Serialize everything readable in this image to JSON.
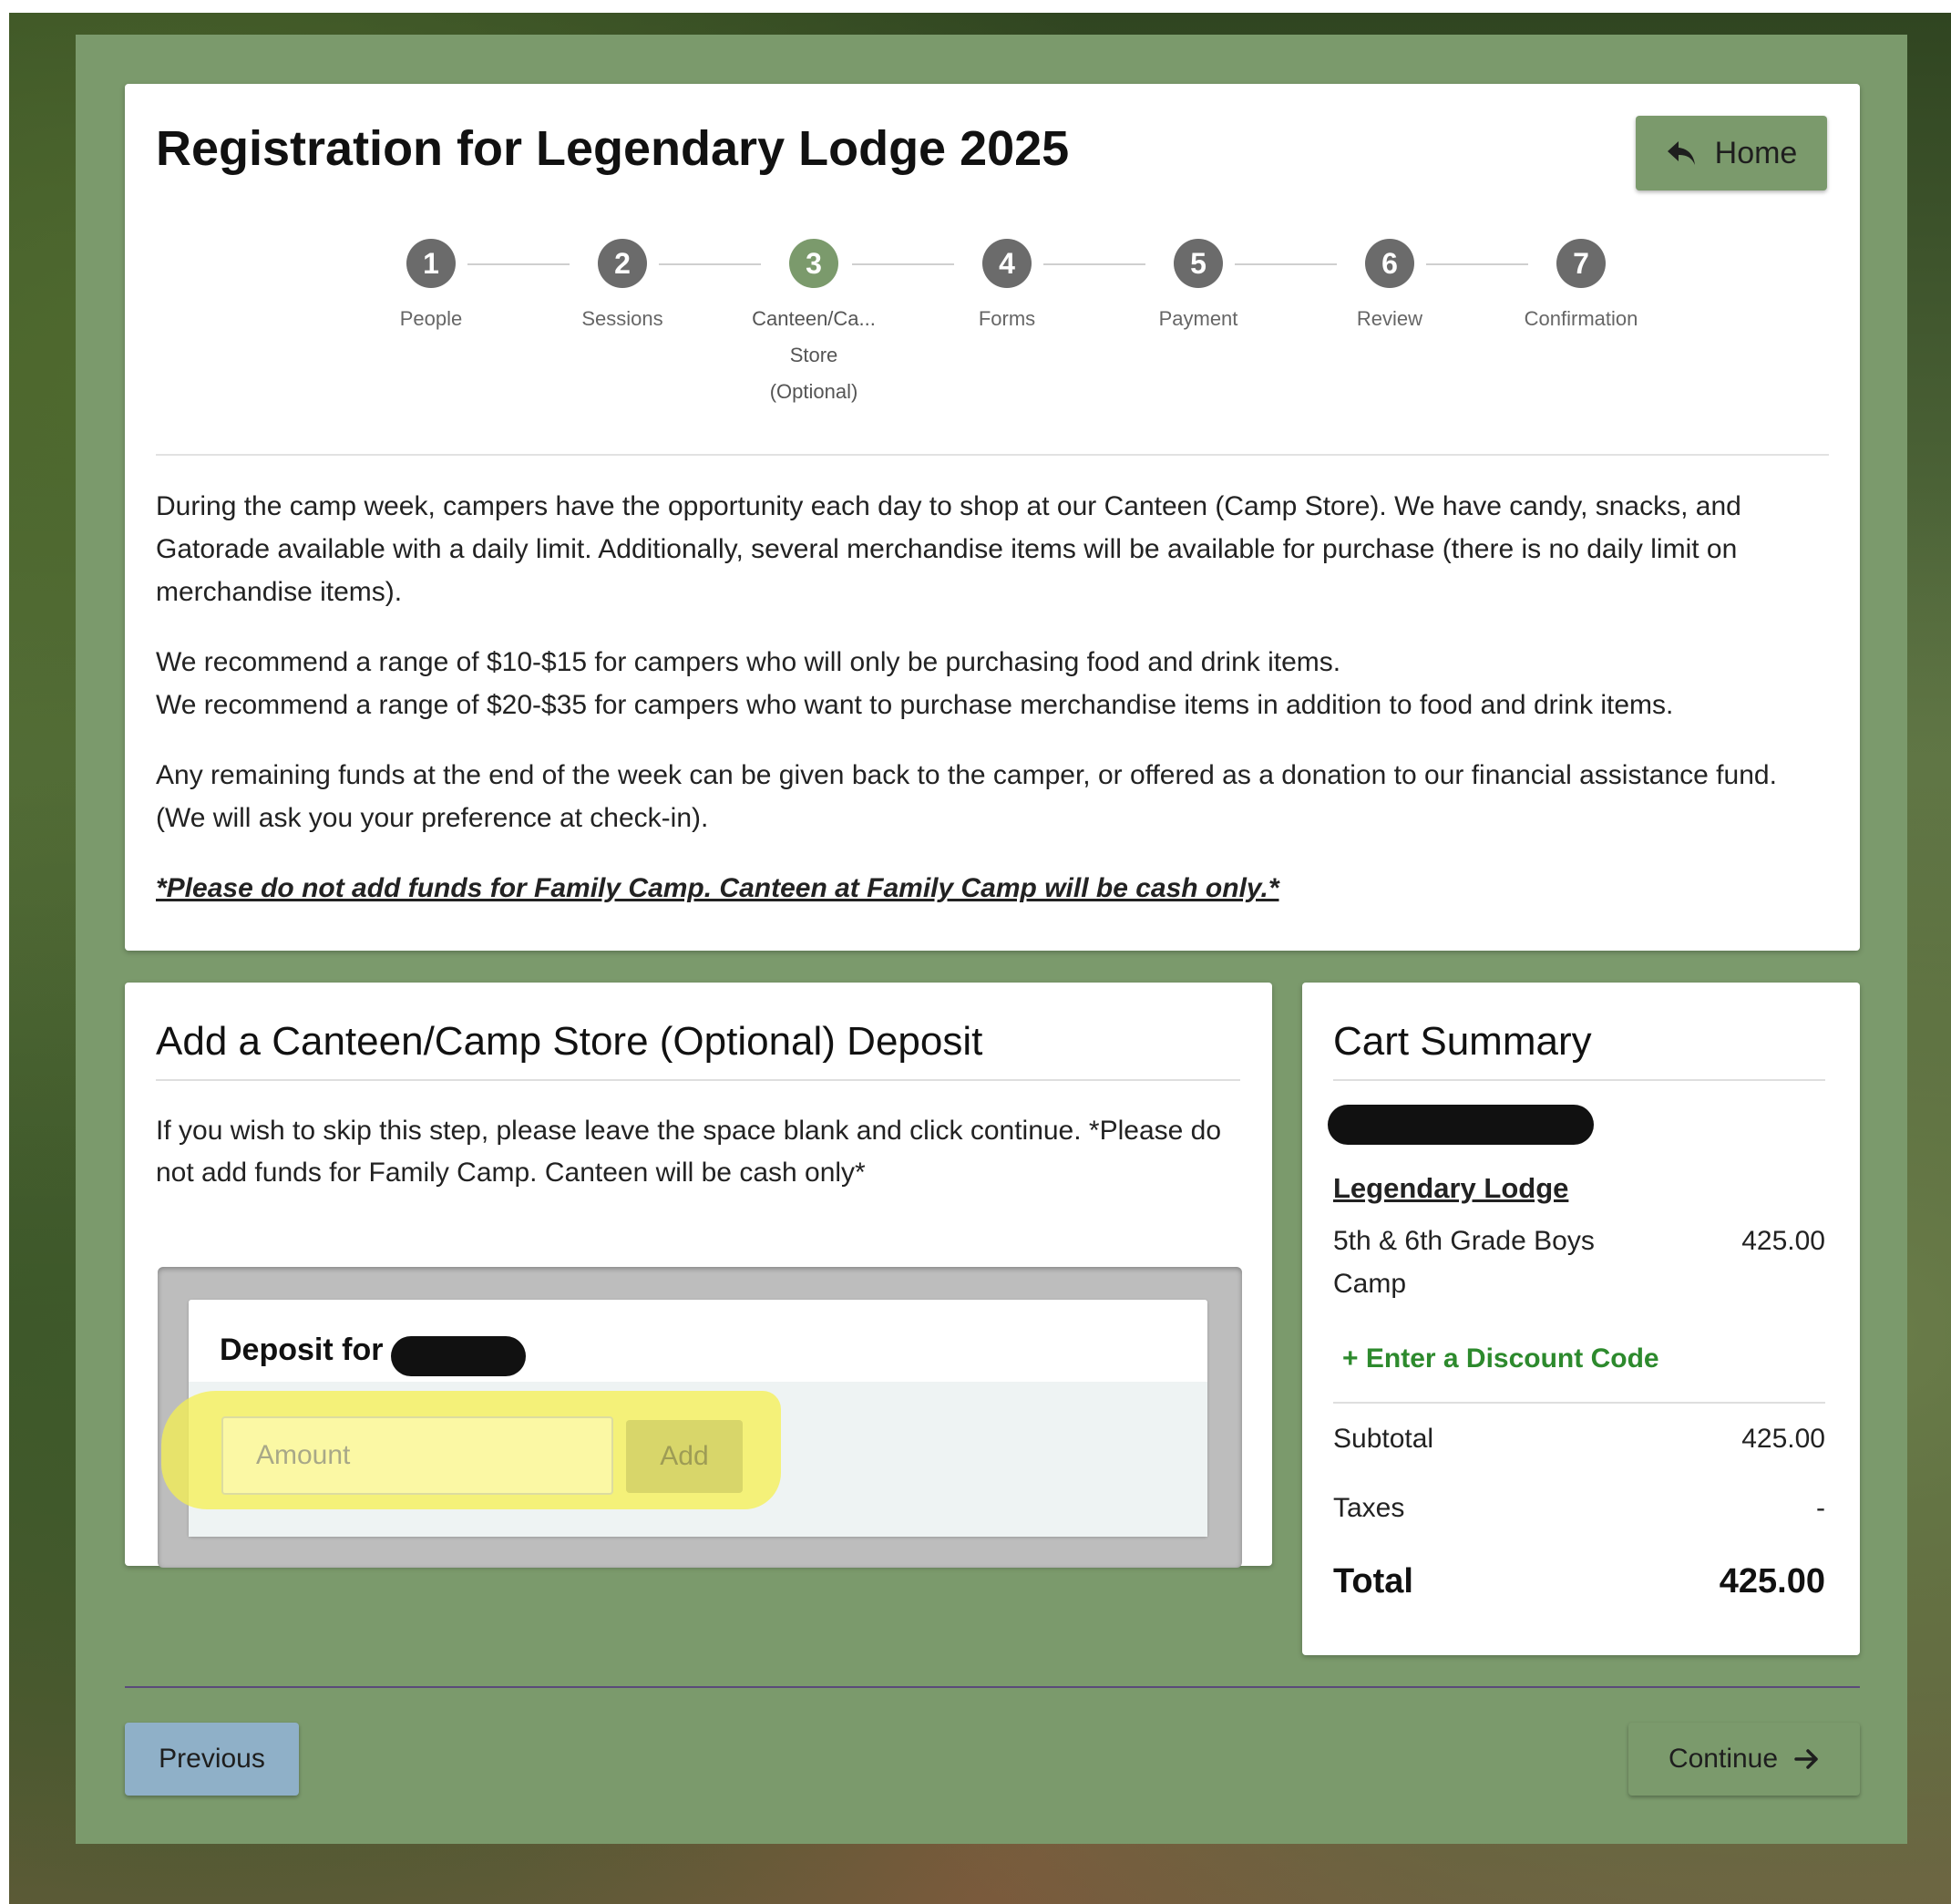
{
  "page": {
    "title": "Registration for Legendary Lodge 2025",
    "home_label": "Home"
  },
  "stepper": {
    "steps": [
      {
        "num": "1",
        "label": "People"
      },
      {
        "num": "2",
        "label": "Sessions"
      },
      {
        "num": "3",
        "label_line1": "Canteen/Ca...",
        "label_line2": "Store",
        "label_line3": "(Optional)"
      },
      {
        "num": "4",
        "label": "Forms"
      },
      {
        "num": "5",
        "label": "Payment"
      },
      {
        "num": "6",
        "label": "Review"
      },
      {
        "num": "7",
        "label": "Confirmation"
      }
    ],
    "active_step": "3"
  },
  "intro": {
    "p1": "During the camp week, campers have the opportunity each day to shop at our Canteen (Camp Store). We have candy, snacks, and Gatorade available with a daily limit. Additionally, several merchandise items will be available for purchase (there is no daily limit on merchandise items).",
    "p2a": "We recommend a range of $10-$15 for campers who will only be purchasing food and drink items.",
    "p2b": "We recommend a range of $20-$35 for campers who want to purchase merchandise items in addition to food and drink items.",
    "p3": "Any remaining funds at the end of the week can be given back to the camper, or offered as a donation to our financial assistance fund. (We will ask you your preference at check-in).",
    "notice": "*Please do not add funds for Family Camp. Canteen at Family Camp will be cash only.*"
  },
  "deposit": {
    "title": "Add a Canteen/Camp Store (Optional) Deposit",
    "description": "If you wish to skip this step, please leave the space blank and click continue. *Please do not add funds for Family Camp. Canteen will be cash only*",
    "heading": "Deposit for",
    "amount_placeholder": "Amount",
    "add_label": "Add"
  },
  "cart": {
    "title": "Cart Summary",
    "camp_link": "Legendary Lodge",
    "item_name": "5th & 6th Grade Boys Camp",
    "item_price": "425.00",
    "discount_label": "Enter a Discount Code",
    "subtotal_label": "Subtotal",
    "subtotal_value": "425.00",
    "taxes_label": "Taxes",
    "taxes_value": "-",
    "total_label": "Total",
    "total_value": "425.00"
  },
  "nav": {
    "previous_label": "Previous",
    "continue_label": "Continue"
  },
  "colors": {
    "frame": "#7b9a6c",
    "step_inactive": "#6b6b6b",
    "previous_button": "#8fb0c8",
    "discount_link": "#2d8a2d",
    "highlight": "#f5f050"
  }
}
